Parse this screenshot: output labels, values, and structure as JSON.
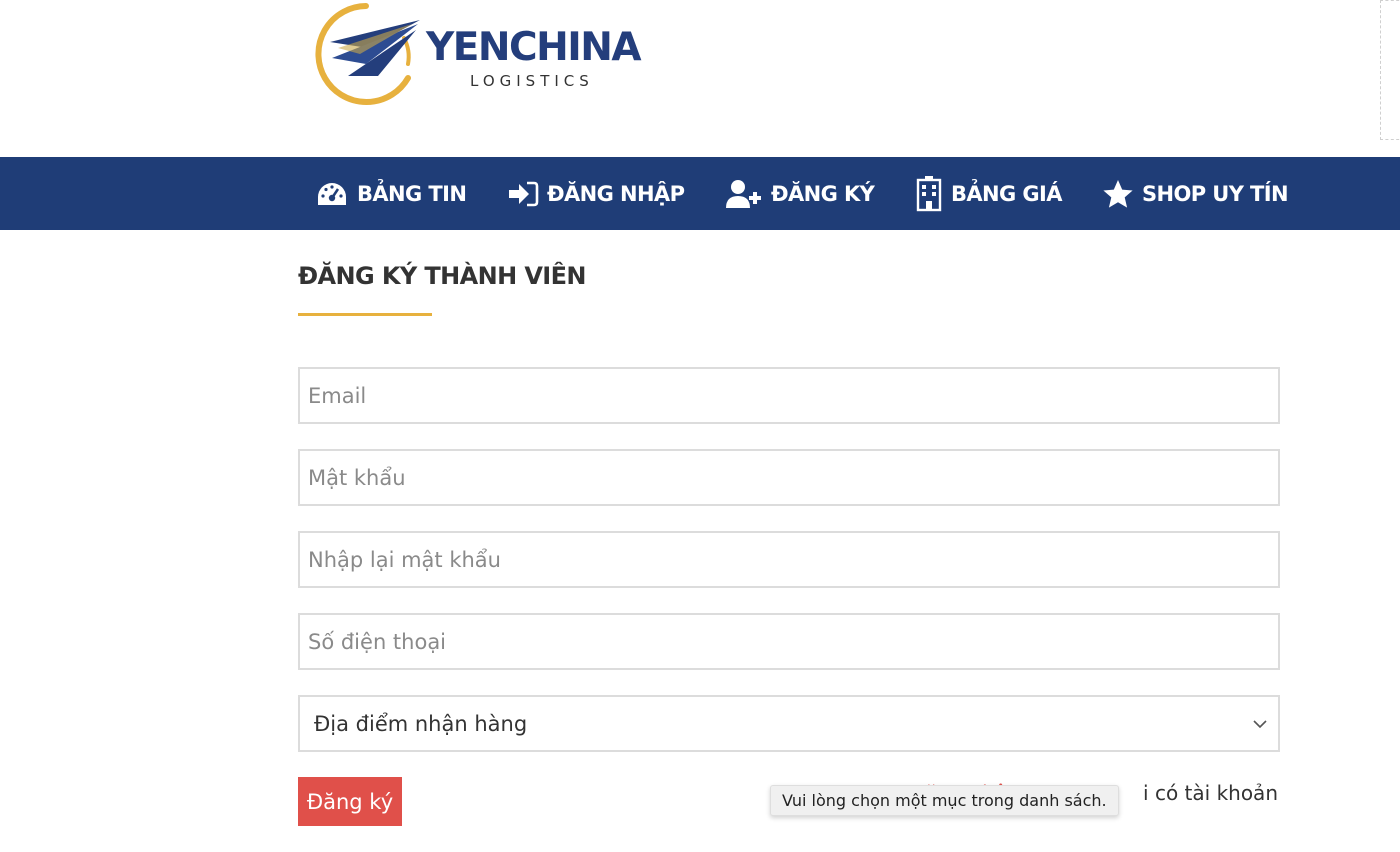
{
  "brand": {
    "name": "YENCHINA",
    "tagline": "LOGISTICS",
    "colors": {
      "primary": "#1f3d77",
      "accent": "#e7b13e",
      "danger": "#e0504a"
    }
  },
  "nav": {
    "items": [
      {
        "label": "BẢNG TIN",
        "icon": "dashboard-icon"
      },
      {
        "label": "ĐĂNG NHẬP",
        "icon": "sign-in-icon"
      },
      {
        "label": "ĐĂNG KÝ",
        "icon": "user-plus-icon"
      },
      {
        "label": "BẢNG GIÁ",
        "icon": "building-icon"
      },
      {
        "label": "SHOP UY TÍN",
        "icon": "star-icon"
      }
    ]
  },
  "page": {
    "title": "ĐĂNG KÝ THÀNH VIÊN"
  },
  "form": {
    "email_placeholder": "Email",
    "password_placeholder": "Mật khẩu",
    "confirm_password_placeholder": "Nhập lại mật khẩu",
    "phone_placeholder": "Số điện thoại",
    "location_select": "Địa điểm nhận hàng",
    "submit_label": "Đăng ký",
    "login_link": "Đăng nhập",
    "login_suffix": "i có tài khoản"
  },
  "tooltip": {
    "text": "Vui lòng chọn một mục trong danh sách."
  }
}
